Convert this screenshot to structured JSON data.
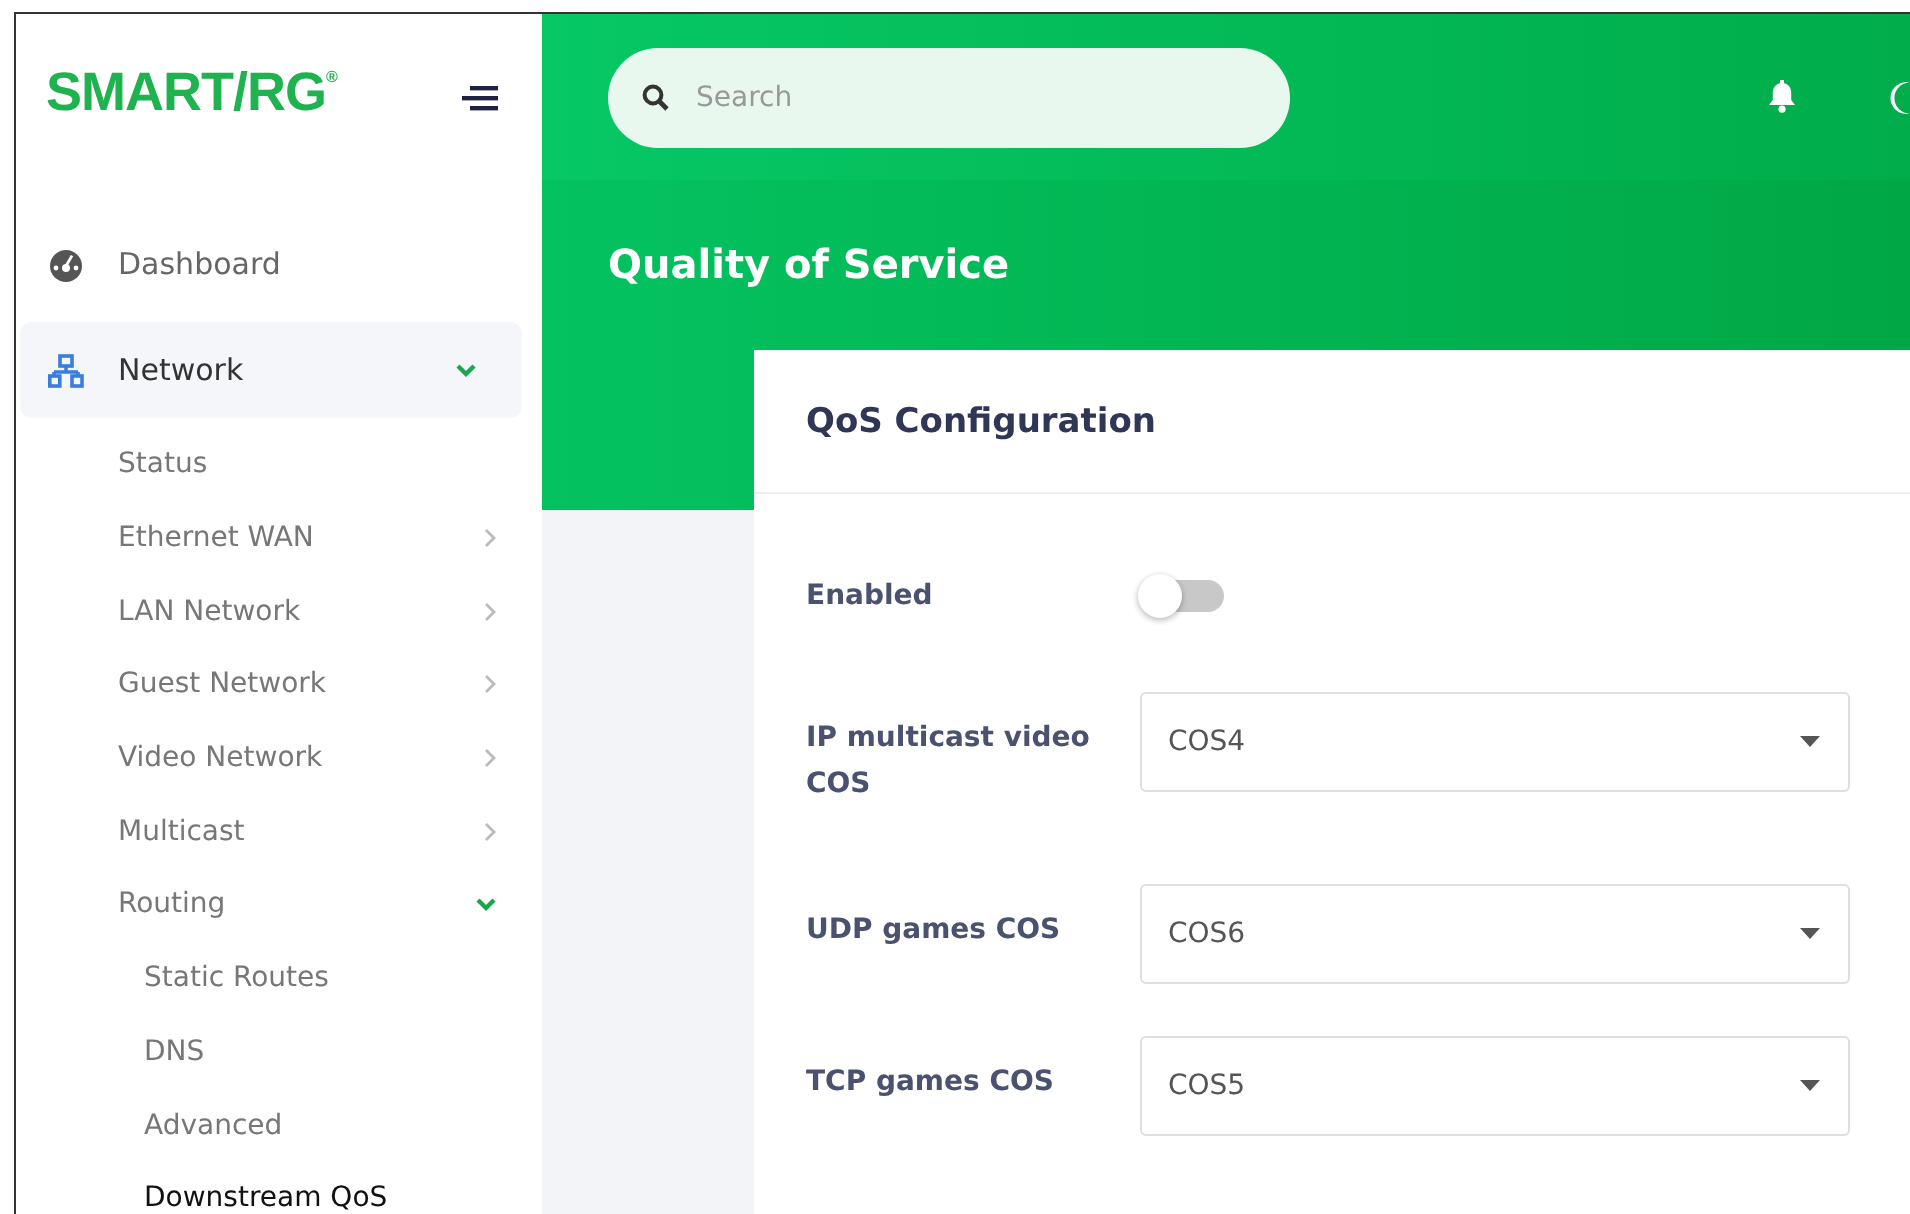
{
  "sidebar": {
    "logo": "SMART/RG$^{®}$",
    "items": [
      {
        "label": "Dashboard",
        "selected": false
      },
      {
        "label": "Network",
        "selected": false,
        "expanded": true,
        "children": [
          {
            "label": "Status",
            "selected": false
          },
          {
            "label": "Ethernet WAN",
            "selected": false,
            "expanded": false
          },
          {
            "label": "LAN Network",
            "selected": false,
            "expanded": false
          },
          {
            "label": "Guest Network",
            "selected": false,
            "expanded": false
          },
          {
            "label": "Video Network",
            "selected": false,
            "expanded": false
          },
          {
            "label": "Multicast",
            "selected": false,
            "expanded": false
          },
          {
            "label": "Routing",
            "selected": false,
            "expanded": true,
            "children": [
              {
                "label": "Static Routes",
                "selected": false
              },
              {
                "label": "DNS",
                "selected": false
              },
              {
                "label": "Advanced",
                "selected": false
              },
              {
                "label": "Downstream QoS",
                "selected": true
              }
            ]
          }
        ]
      }
    ]
  },
  "header": {
    "search": {
      "placeholder": "Search"
    }
  },
  "page_title": "Quality of Service",
  "card": {
    "title": "QoS Configuration",
    "fields": [
      {
        "kind": "toggle",
        "label": "Enabled",
        "on": false
      },
      {
        "kind": "select",
        "label": "IP multicast video COS",
        "value": "COS4"
      },
      {
        "kind": "select",
        "label": "UDP games COS",
        "value": "COS6"
      },
      {
        "kind": "select",
        "label": "TCP games COS",
        "value": "COS5"
      }
    ]
  }
}
